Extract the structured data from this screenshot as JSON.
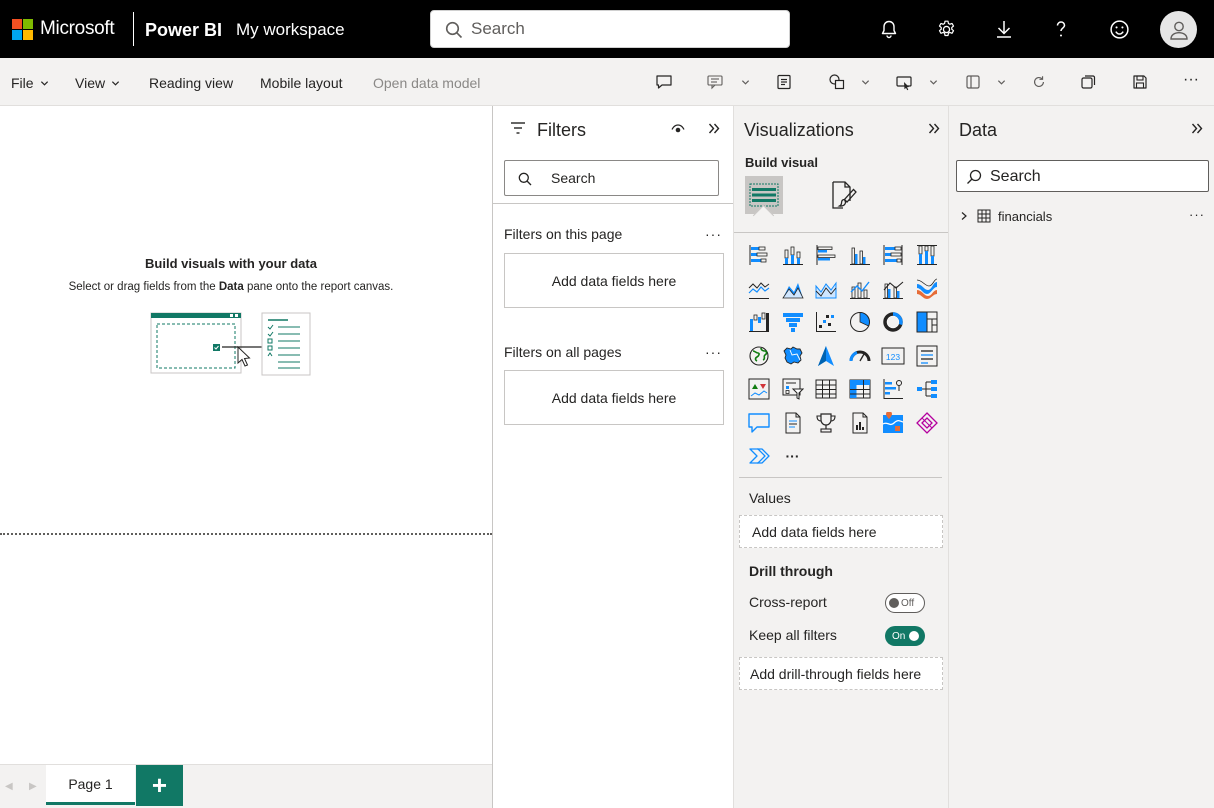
{
  "header": {
    "brand": "Microsoft",
    "product": "Power BI",
    "workspace": "My workspace",
    "search_placeholder": "Search",
    "logo_colors": [
      "#f25022",
      "#7fba00",
      "#00a4ef",
      "#ffb900"
    ],
    "icons": [
      "bell-icon",
      "gear-icon",
      "download-icon",
      "help-icon",
      "smiley-icon"
    ]
  },
  "toolbar": {
    "file": "File",
    "view": "View",
    "reading_view": "Reading view",
    "mobile_layout": "Mobile layout",
    "open_data_model": "Open data model",
    "overflow": "···"
  },
  "canvas": {
    "empty_title": "Build visuals with your data",
    "empty_desc_before": "Select or drag fields from the ",
    "empty_desc_bold": "Data",
    "empty_desc_after": " pane onto the report canvas."
  },
  "pages": {
    "tabs": [
      "Page 1"
    ],
    "add_label": "+"
  },
  "filters": {
    "title": "Filters",
    "search_placeholder": "Search",
    "on_this_page": "Filters on this page",
    "on_all_pages": "Filters on all pages",
    "add_fields": "Add data fields here",
    "more": "···"
  },
  "visualizations": {
    "title": "Visualizations",
    "build_visual": "Build visual",
    "more": "···",
    "values_label": "Values",
    "values_well": "Add data fields here",
    "drill_through": "Drill through",
    "cross_report": "Cross-report",
    "cross_report_state": "Off",
    "keep_all_filters": "Keep all filters",
    "keep_all_filters_state": "On",
    "drill_well": "Add drill-through fields here",
    "accent": "#117865"
  },
  "data_pane": {
    "title": "Data",
    "search_placeholder": "Search",
    "tables": [
      {
        "name": "financials"
      }
    ],
    "more": "···"
  }
}
